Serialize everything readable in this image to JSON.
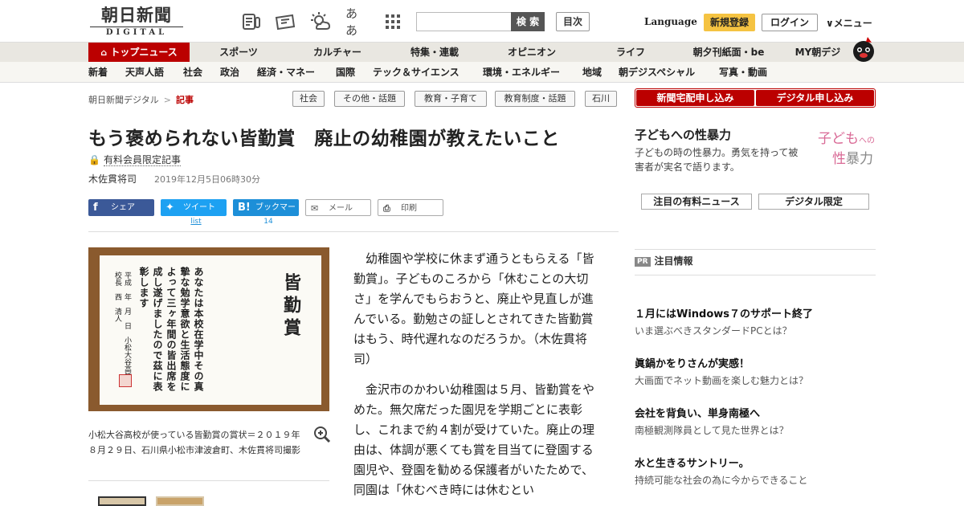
{
  "header": {
    "logo_main": "朝日新聞",
    "logo_sub": "DIGITAL",
    "icons": [
      "newspaper-icon",
      "ticket-icon",
      "weather-icon",
      "font-size-icon",
      "apps-grid-icon"
    ],
    "font_size_label": "ああ",
    "search_placeholder": "",
    "search_button": "検 索",
    "toc_button": "目次",
    "language": "Language",
    "register": "新規登録",
    "login": "ログイン",
    "menu": "∨メニュー"
  },
  "nav_main": [
    "トップニュース",
    "スポーツ",
    "カルチャー",
    "特集・連載",
    "オピニオン",
    "ライフ",
    "朝夕刊紙面・be",
    "MY朝デジ"
  ],
  "nav_sub": [
    "新着",
    "天声人語",
    "社会",
    "政治",
    "経済・マネー",
    "国際",
    "テック＆サイエンス",
    "環境・エネルギー",
    "地域",
    "朝デジスペシャル",
    "写真・動画"
  ],
  "breadcrumb": {
    "home": "朝日新聞デジタル",
    "separator": ">",
    "current": "記事"
  },
  "tags": [
    "社会",
    "その他・話題",
    "教育・子育て",
    "教育制度・話題",
    "石川"
  ],
  "article": {
    "title": "もう褒められない皆勤賞　廃止の幼稚園が教えたいこと",
    "paid_label": "有料会員限定記事",
    "author": "木佐貫将司",
    "date": "2019年12月5日06時30分",
    "share": {
      "facebook": "シェア",
      "twitter": "ツイート",
      "twitter_count": "list",
      "hatena": "ブックマーク",
      "hatena_count": "14",
      "mail": "メール",
      "print": "印刷"
    },
    "photo": {
      "cert_title": "皆勤賞",
      "cert_body": "あなたは本校在学中その真摯な勉学意欲と生活態度によって三ヶ年間の皆出席を成し遂げましたので茲に表彰します",
      "cert_sign": "平成　年　月　日　小松大谷高等学校長　西　清人"
    },
    "caption": "小松大谷高校が使っている皆勤賞の賞状＝２０１９年８月２９日、石川県小松市津波倉町、木佐貫将司撮影",
    "paragraphs": [
      "幼稚園や学校に休まず通うともらえる「皆勤賞」。子どものころから「休むことの大切さ」を学んでもらおうと、廃止や見直しが進んでいる。勤勉さの証しとされてきた皆勤賞はもう、時代遅れなのだろうか。（木佐貫将司）",
      "金沢市のかわい幼稚園は５月、皆勤賞をやめた。無欠席だった園児を学期ごとに表彰し、これまで約４割が受けていた。廃止の理由は、体調が悪くても賞を目当てに登園する園児や、登園を勧める保護者がいたためで、同園は「休むべき時には休むとい"
    ]
  },
  "sidebar": {
    "subscribe_paper": "新聞宅配申し込み",
    "subscribe_digital": "デジタル申し込み",
    "feature_title": "子どもへの性暴力",
    "feature_desc": "子どもの時の性暴力。勇気を持って被害者が実名で語ります。",
    "feature_logo_1": "子ども",
    "feature_logo_2": "への",
    "feature_logo_3": "性",
    "feature_logo_4": "暴力",
    "tab_paid": "注目の有料ニュース",
    "tab_digital": "デジタル限定",
    "pr_badge": "PR",
    "pr_label": "注目情報",
    "ads": [
      {
        "title": "１月にはWindows７のサポート終了",
        "sub": "いま選ぶべきスタンダードPCとは？"
      },
      {
        "title": "眞鍋かをりさんが実感！",
        "sub": "大画面でネット動画を楽しむ魅力とは？"
      },
      {
        "title": "会社を背負い、単身南極へ",
        "sub": "南極観測隊員として見た世界とは？"
      },
      {
        "title": "水と生きるサントリー。",
        "sub": "持続可能な社会の為に今からできること"
      }
    ]
  },
  "colors": {
    "brand_red": "#bb0000",
    "register_yellow": "#f5c342",
    "facebook": "#3b5998",
    "twitter": "#1da1f2",
    "hatena": "#1d8fd8"
  }
}
